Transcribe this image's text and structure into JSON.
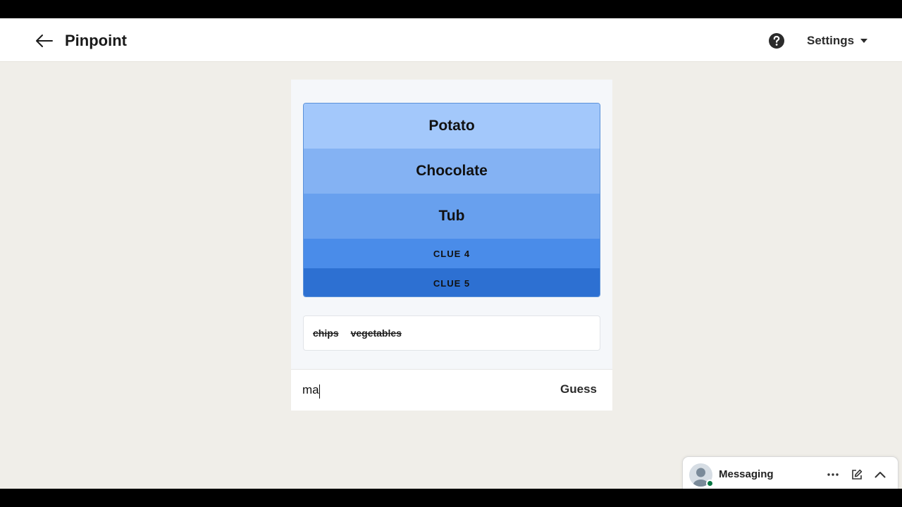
{
  "header": {
    "title": "Pinpoint",
    "settings_label": "Settings"
  },
  "clues": [
    {
      "label": "Potato",
      "revealed": true,
      "color": "#a3c8fb"
    },
    {
      "label": "Chocolate",
      "revealed": true,
      "color": "#84b2f3"
    },
    {
      "label": "Tub",
      "revealed": true,
      "color": "#68a0ee"
    },
    {
      "label": "CLUE 4",
      "revealed": false,
      "color": "#4a8ce9"
    },
    {
      "label": "CLUE 5",
      "revealed": false,
      "color": "#2d70d2"
    }
  ],
  "wrong_guesses": [
    "chips",
    "vegetables"
  ],
  "guess": {
    "value": "ma",
    "button_label": "Guess"
  },
  "messaging": {
    "label": "Messaging"
  }
}
